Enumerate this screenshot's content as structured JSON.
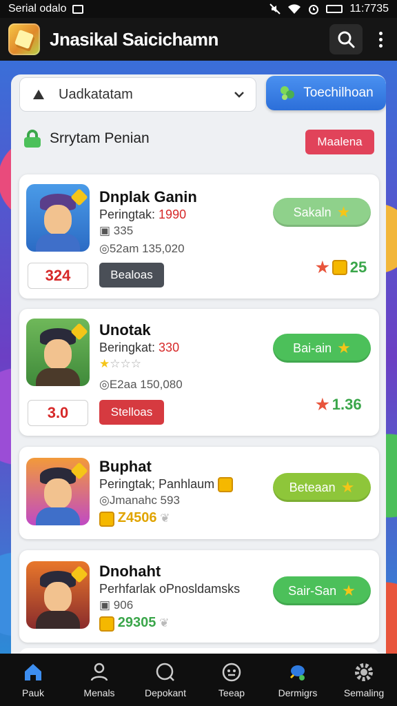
{
  "status_bar": {
    "left_text": "Serial odalo",
    "time": "11:7735"
  },
  "app_bar": {
    "title": "Jnasikal Saicichamn"
  },
  "filter": {
    "dropdown_value": "Uadkatatam",
    "primary_button": "Toechilhoan",
    "section_label": "Srrytam Penian",
    "manage_button": "Maalena"
  },
  "cards": [
    {
      "name": "Dnplak Ganin",
      "line1_prefix": "Peringtak: ",
      "line1_value": "1990",
      "line2": "335",
      "line3": "52am 135,020",
      "score": "324",
      "tag": "Bealoas",
      "action": "Sakaln",
      "rating": "25"
    },
    {
      "name": "Unotak",
      "line1_prefix": "Beringkat: ",
      "line1_value": "330",
      "line2_stars": 1,
      "line3": "E2aa 150,080",
      "score": "3.0",
      "tag": "Stelloas",
      "action": "Bai-ain",
      "rating": "1.36"
    },
    {
      "name": "Buphat",
      "line1_prefix": "Peringtak; Panhlaum",
      "line2": "Jmanahc 593",
      "gold": "Z4506",
      "action": "Beteaan"
    },
    {
      "name": "Dnohaht",
      "line1_prefix": "Perhfarlak oPnosldamsks",
      "line2": "906",
      "gold": "29305",
      "action": "Sair-San"
    }
  ],
  "bottom_nav": [
    {
      "label": "Pauk",
      "icon": "home-icon"
    },
    {
      "label": "Menals",
      "icon": "user-icon"
    },
    {
      "label": "Depokant",
      "icon": "search-icon"
    },
    {
      "label": "Teeap",
      "icon": "face-icon"
    },
    {
      "label": "Dermigrs",
      "icon": "map-icon"
    },
    {
      "label": "Semaling",
      "icon": "gear-icon"
    }
  ],
  "colors": {
    "primary": "#2c6fd9",
    "action_green": "#4cc05a",
    "danger": "#e1435a",
    "dark": "#151515"
  }
}
